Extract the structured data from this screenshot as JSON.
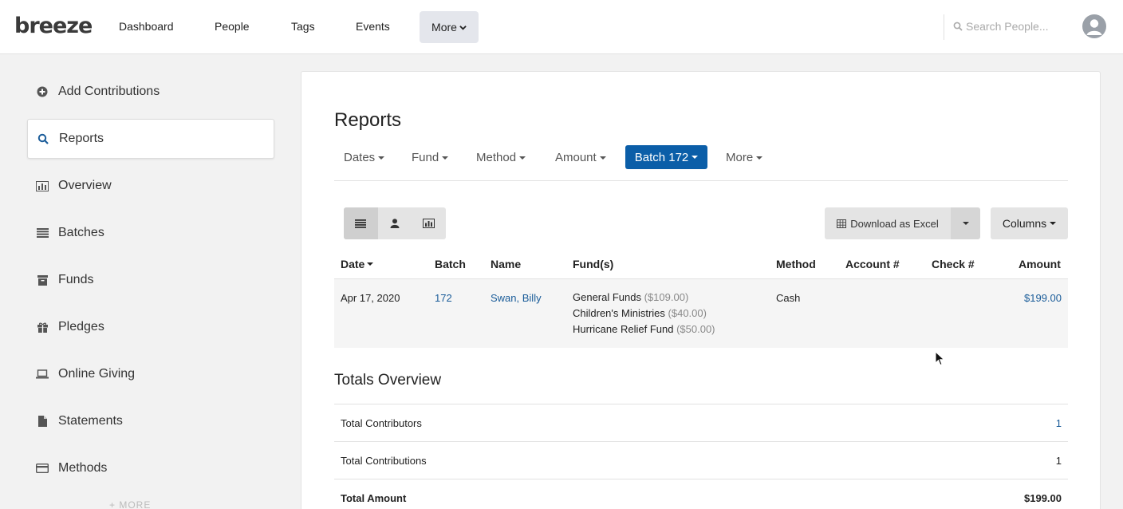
{
  "topbar": {
    "logo": "breeze",
    "nav": [
      "Dashboard",
      "People",
      "Tags",
      "Events"
    ],
    "more_label": "More",
    "search_placeholder": "Search People..."
  },
  "sidebar": {
    "items": [
      {
        "label": "Add Contributions",
        "icon": "plus-circle-icon"
      },
      {
        "label": "Reports",
        "icon": "search-icon",
        "active": true
      },
      {
        "label": "Overview",
        "icon": "bar-chart-icon"
      },
      {
        "label": "Batches",
        "icon": "list-icon"
      },
      {
        "label": "Funds",
        "icon": "archive-box-icon"
      },
      {
        "label": "Pledges",
        "icon": "gift-icon"
      },
      {
        "label": "Online Giving",
        "icon": "laptop-icon"
      },
      {
        "label": "Statements",
        "icon": "document-icon"
      },
      {
        "label": "Methods",
        "icon": "credit-card-icon"
      }
    ],
    "more_label": "MORE"
  },
  "main": {
    "title": "Reports",
    "filters": [
      "Dates",
      "Fund",
      "Method",
      "Amount"
    ],
    "active_filter": "Batch 172",
    "more_filter": "More",
    "download_label": "Download as Excel",
    "columns_label": "Columns",
    "table": {
      "headers": [
        "Date",
        "Batch",
        "Name",
        "Fund(s)",
        "Method",
        "Account #",
        "Check #",
        "Amount"
      ],
      "rows": [
        {
          "date": "Apr 17, 2020",
          "batch": "172",
          "name": "Swan, Billy",
          "funds": [
            {
              "name": "General Funds",
              "amount": "($109.00)"
            },
            {
              "name": "Children's Ministries",
              "amount": "($40.00)"
            },
            {
              "name": "Hurricane Relief Fund",
              "amount": "($50.00)"
            }
          ],
          "method": "Cash",
          "account": "",
          "check": "",
          "amount": "$199.00"
        }
      ]
    },
    "totals": {
      "title": "Totals Overview",
      "rows": [
        {
          "label": "Total Contributors",
          "value": "1"
        },
        {
          "label": "Total Contributions",
          "value": "1"
        },
        {
          "label": "Total Amount",
          "value": "$199.00"
        }
      ]
    }
  },
  "colors": {
    "accent": "#0b5ea8",
    "link": "#1a5c99"
  }
}
